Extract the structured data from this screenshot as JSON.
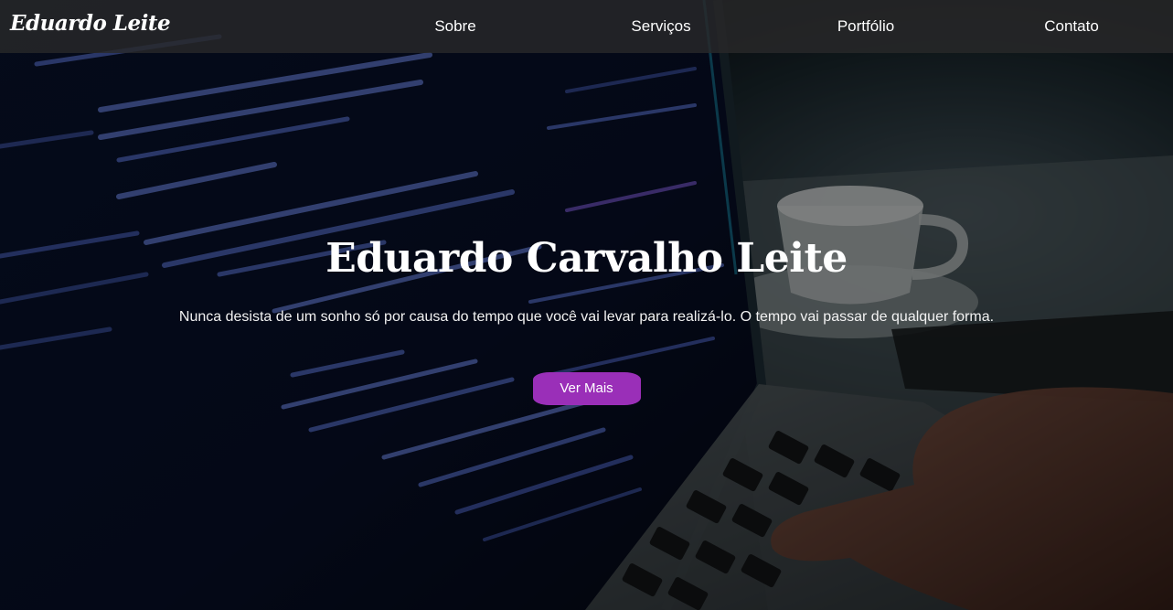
{
  "navbar": {
    "brand": "Eduardo Leite",
    "links": [
      {
        "label": "Sobre"
      },
      {
        "label": "Serviços"
      },
      {
        "label": "Portfólio"
      },
      {
        "label": "Contato"
      }
    ]
  },
  "hero": {
    "title": "Eduardo Carvalho Leite",
    "quote": "Nunca desista de um sonho só por causa do tempo que você vai levar para realizá-lo. O tempo vai passar de qualquer forma.",
    "cta_label": "Ver Mais"
  },
  "colors": {
    "accent": "#9a2fb8",
    "navbar_bg": "#28282a",
    "text": "#ffffff"
  }
}
